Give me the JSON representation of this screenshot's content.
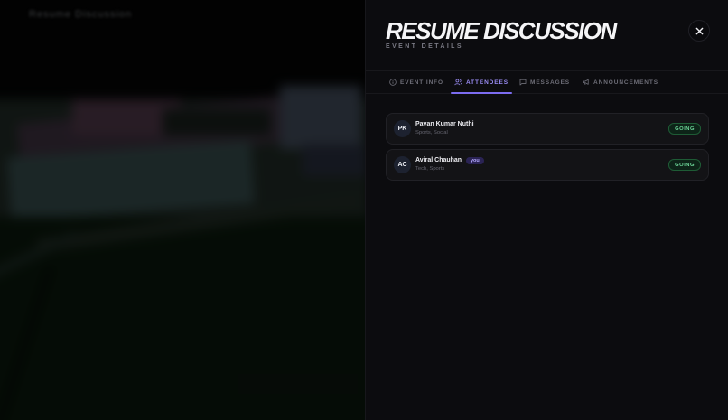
{
  "background": {
    "nav_text": "Resume Discussion"
  },
  "panel": {
    "title": "RESUME DISCUSSION",
    "subtitle": "EVENT DETAILS",
    "close_icon": "close-icon"
  },
  "tabs": [
    {
      "label": "EVENT INFO",
      "icon": "info-icon",
      "active": false
    },
    {
      "label": "ATTENDEES",
      "icon": "users-icon",
      "active": true
    },
    {
      "label": "MESSAGES",
      "icon": "chat-icon",
      "active": false
    },
    {
      "label": "ANNOUNCEMENTS",
      "icon": "megaphone-icon",
      "active": false
    }
  ],
  "attendees": [
    {
      "initials": "PK",
      "name": "Pavan Kumar Nuthi",
      "tags": "Sports, Social",
      "status": "GOING"
    },
    {
      "initials": "AC",
      "name": "Aviral Chauhan",
      "badge": "you",
      "tags": "Tech, Sports",
      "status": "GOING"
    }
  ],
  "colors": {
    "accent": "#7c6cf0",
    "going_text": "#6ed89a",
    "panel_bg": "#0c0c0f"
  }
}
